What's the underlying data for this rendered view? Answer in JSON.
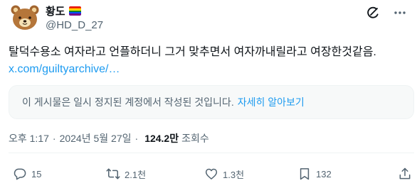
{
  "author": {
    "display_name": "황도",
    "handle": "@HD_D_27",
    "avatar_icon": "rilakkuma-bear-avatar",
    "flag_icon": "rainbow-flag-icon",
    "flag_colors": [
      "#e40303",
      "#ff8c00",
      "#ffed00",
      "#008026",
      "#004dff",
      "#750787"
    ]
  },
  "header": {
    "grok_icon": "grok-icon",
    "more_icon": "more-icon"
  },
  "tweet": {
    "text": "탈덕수용소 여자라고 언플하더니 그거 맞추면서 여자까내릴라고 여장한것같음.",
    "link": "x.com/guiltyarchive/…"
  },
  "quoted_notice": {
    "text": "이 게시물은 일시 정지된 계정에서 작성된 것입니다.",
    "link": "자세히 알아보기"
  },
  "meta": {
    "time": "오후 1:17",
    "separator": "·",
    "date": "2024년 5월 27일",
    "views_count": "124.2만",
    "views_label": "조회수"
  },
  "actions": {
    "replies": "15",
    "reposts": "2.1천",
    "likes": "1.3천",
    "bookmarks": "132"
  },
  "colors": {
    "text": "#0f1419",
    "secondary": "#536471",
    "accent": "#1d9bf0",
    "notice_bg": "#f7f9f9"
  }
}
